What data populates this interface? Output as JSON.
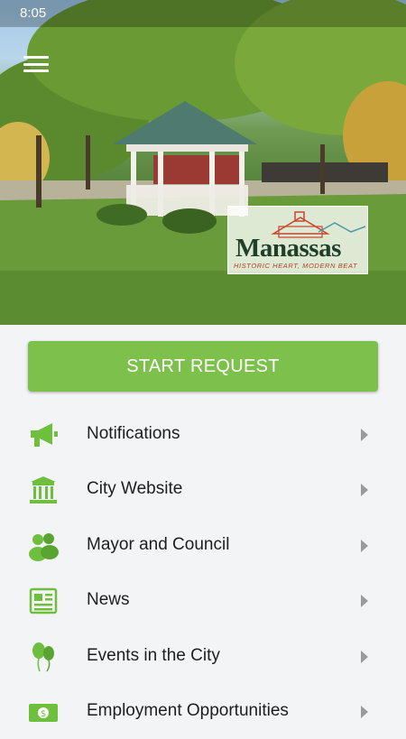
{
  "status_bar": {
    "time": "8:05"
  },
  "hero": {
    "logo": {
      "wordmark": "Manassas",
      "tagline": "HISTORIC HEART, MODERN BEAT"
    }
  },
  "cta": {
    "label": "START REQUEST"
  },
  "menu": {
    "items": [
      {
        "label": "Notifications",
        "icon": "megaphone-icon"
      },
      {
        "label": "City Website",
        "icon": "building-icon"
      },
      {
        "label": "Mayor and Council",
        "icon": "people-icon"
      },
      {
        "label": "News",
        "icon": "newspaper-icon"
      },
      {
        "label": "Events in the City",
        "icon": "balloons-icon"
      },
      {
        "label": "Employment Opportunities",
        "icon": "money-icon"
      }
    ]
  },
  "colors": {
    "accent": "#7dc04c",
    "icon_green": "#6fbf3f",
    "chevron": "#9a9a9a"
  }
}
